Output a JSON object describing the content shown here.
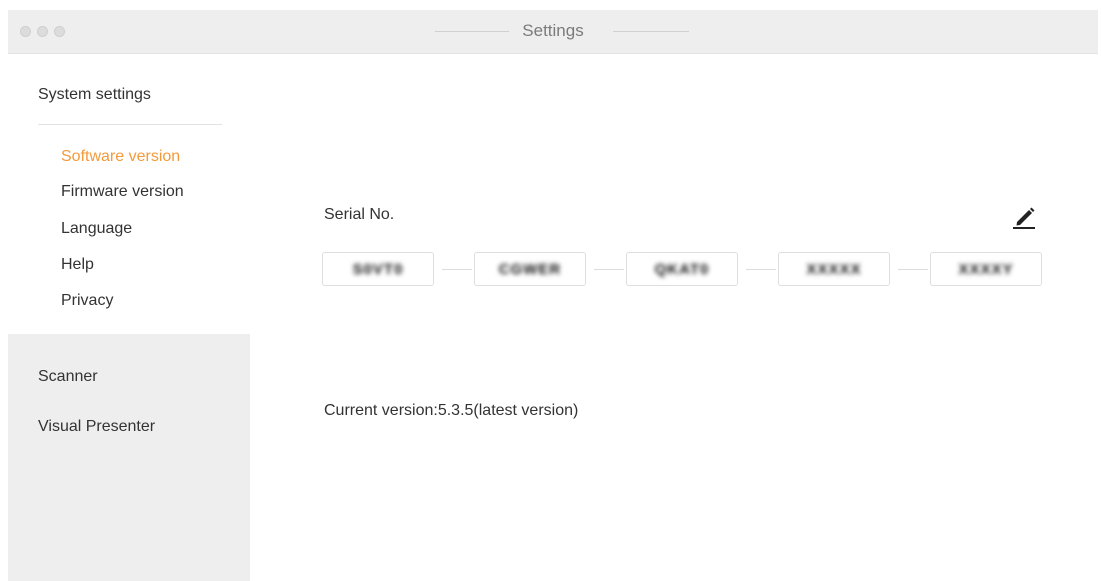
{
  "window": {
    "title": "Settings"
  },
  "sidebar": {
    "system_heading": "System settings",
    "sub_items": [
      {
        "label": "Software version",
        "active": true
      },
      {
        "label": "Firmware version",
        "active": false
      },
      {
        "label": "Language",
        "active": false
      },
      {
        "label": "Help",
        "active": false
      },
      {
        "label": "Privacy",
        "active": false
      }
    ],
    "categories": [
      {
        "label": "Scanner"
      },
      {
        "label": "Visual Presenter"
      }
    ]
  },
  "main": {
    "serial_label": "Serial No.",
    "serial_fields": [
      "S0VT0",
      "CGWER",
      "QKAT0",
      "XXXXX",
      "XXXXY"
    ],
    "current_version": "Current version:5.3.5(latest version)"
  },
  "colors": {
    "accent": "#f39a3b",
    "sidebar_bg": "#eeeeee",
    "titlebar_bg": "#eeeeee",
    "text": "#333333"
  },
  "icons": {
    "edit": "pencil-icon"
  }
}
